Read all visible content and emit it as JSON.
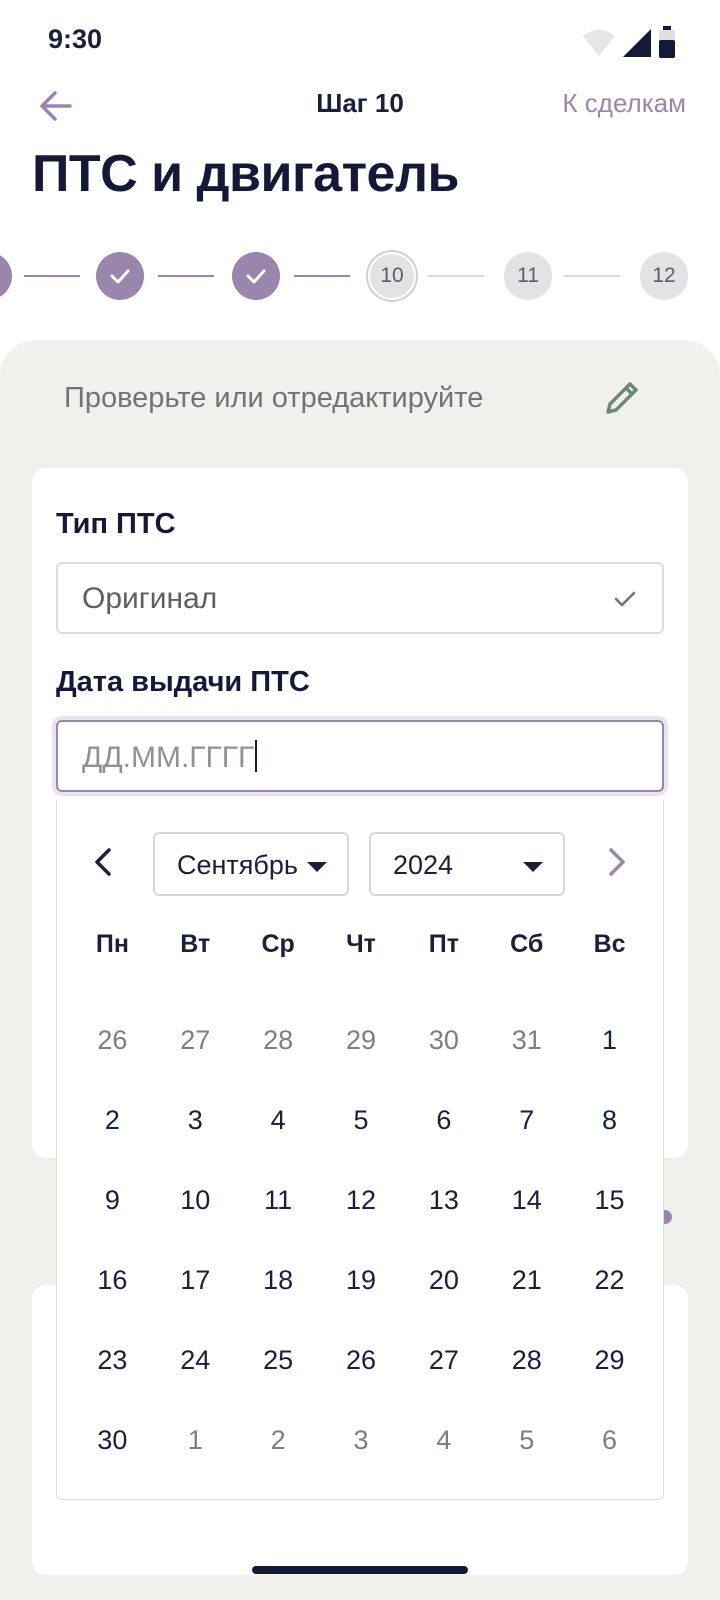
{
  "status_bar": {
    "time": "9:30",
    "icons": [
      "wifi-icon",
      "signal-icon",
      "battery-icon"
    ]
  },
  "nav": {
    "back_icon": "arrow-left-icon",
    "step_title": "Шаг 10",
    "deals_link": "К сделкам"
  },
  "page_title": "ПТС и двигатель",
  "stepper": {
    "steps": [
      {
        "label": "",
        "state": "done"
      },
      {
        "label": "",
        "state": "done"
      },
      {
        "label": "",
        "state": "done"
      },
      {
        "label": "10",
        "state": "current"
      },
      {
        "label": "11",
        "state": "pending"
      },
      {
        "label": "12",
        "state": "pending"
      }
    ]
  },
  "panel": {
    "hint": "Проверьте или отредактируйте",
    "edit_icon": "pencil-icon"
  },
  "form": {
    "pts_type_label": "Тип ПТС",
    "pts_type_value": "Оригинал",
    "pts_date_label": "Дата выдачи ПТС",
    "pts_date_placeholder": "ДД.ММ.ГГГГ"
  },
  "calendar": {
    "month": "Сентябрь",
    "year": "2024",
    "weekdays": [
      "Пн",
      "Вт",
      "Ср",
      "Чт",
      "Пт",
      "Сб",
      "Вс"
    ],
    "days": [
      {
        "d": "26",
        "muted": true
      },
      {
        "d": "27",
        "muted": true
      },
      {
        "d": "28",
        "muted": true
      },
      {
        "d": "29",
        "muted": true
      },
      {
        "d": "30",
        "muted": true
      },
      {
        "d": "31",
        "muted": true
      },
      {
        "d": "1",
        "muted": false
      },
      {
        "d": "2",
        "muted": false
      },
      {
        "d": "3",
        "muted": false
      },
      {
        "d": "4",
        "muted": false
      },
      {
        "d": "5",
        "muted": false
      },
      {
        "d": "6",
        "muted": false
      },
      {
        "d": "7",
        "muted": false
      },
      {
        "d": "8",
        "muted": false
      },
      {
        "d": "9",
        "muted": false
      },
      {
        "d": "10",
        "muted": false
      },
      {
        "d": "11",
        "muted": false
      },
      {
        "d": "12",
        "muted": false
      },
      {
        "d": "13",
        "muted": false
      },
      {
        "d": "14",
        "muted": false
      },
      {
        "d": "15",
        "muted": false
      },
      {
        "d": "16",
        "muted": false
      },
      {
        "d": "17",
        "muted": false
      },
      {
        "d": "18",
        "muted": false
      },
      {
        "d": "19",
        "muted": false
      },
      {
        "d": "20",
        "muted": false
      },
      {
        "d": "21",
        "muted": false
      },
      {
        "d": "22",
        "muted": false
      },
      {
        "d": "23",
        "muted": false
      },
      {
        "d": "24",
        "muted": false
      },
      {
        "d": "25",
        "muted": false
      },
      {
        "d": "26",
        "muted": false
      },
      {
        "d": "27",
        "muted": false
      },
      {
        "d": "28",
        "muted": false
      },
      {
        "d": "29",
        "muted": false
      },
      {
        "d": "30",
        "muted": false
      },
      {
        "d": "1",
        "muted": true
      },
      {
        "d": "2",
        "muted": true
      },
      {
        "d": "3",
        "muted": true
      },
      {
        "d": "4",
        "muted": true
      },
      {
        "d": "5",
        "muted": true
      },
      {
        "d": "6",
        "muted": true
      }
    ]
  },
  "colors": {
    "accent": "#9a86ad",
    "text_dark": "#14193a",
    "panel_bg": "#f0f1ed",
    "edit_icon": "#6b8a74"
  }
}
